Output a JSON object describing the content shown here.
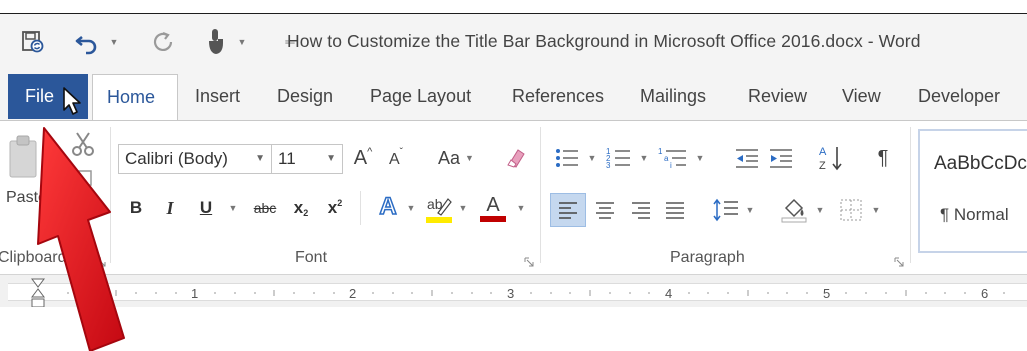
{
  "window": {
    "title": "How to Customize the Title Bar Background in Microsoft Office 2016.docx - Word"
  },
  "quick_access": {
    "items": [
      "save-icon",
      "undo-icon",
      "redo-icon",
      "touch-mode-icon",
      "customize-qat-icon"
    ]
  },
  "tabs": [
    {
      "label": "File"
    },
    {
      "label": "Home"
    },
    {
      "label": "Insert"
    },
    {
      "label": "Design"
    },
    {
      "label": "Page Layout"
    },
    {
      "label": "References"
    },
    {
      "label": "Mailings"
    },
    {
      "label": "Review"
    },
    {
      "label": "View"
    },
    {
      "label": "Developer"
    }
  ],
  "clipboard": {
    "paste_label": "Paste",
    "group_label": "Clipboard"
  },
  "font": {
    "font_name": "Calibri (Body)",
    "font_size": "11",
    "grow_label": "A",
    "shrink_label": "A",
    "change_case_label": "Aa",
    "bold_label": "B",
    "italic_label": "I",
    "underline_label": "U",
    "strike_label": "abc",
    "subscript_label": "x",
    "superscript_label": "x",
    "text_effects_label": "A",
    "font_color_label": "A",
    "group_label": "Font"
  },
  "paragraph": {
    "group_label": "Paragraph",
    "sort_label": "A Z",
    "show_marks_label": "¶"
  },
  "styles": {
    "sample": "AaBbCcDc",
    "normal_label": "¶ Normal"
  },
  "ruler": {
    "numbers": [
      "1",
      "2",
      "3",
      "4",
      "5",
      "6"
    ]
  },
  "colors": {
    "file_tab": "#2b579a",
    "home_tab_text": "#2b579a",
    "highlight_yellow": "#ffeb00",
    "font_red": "#c00000",
    "annotation_arrow": "#e8121b"
  }
}
